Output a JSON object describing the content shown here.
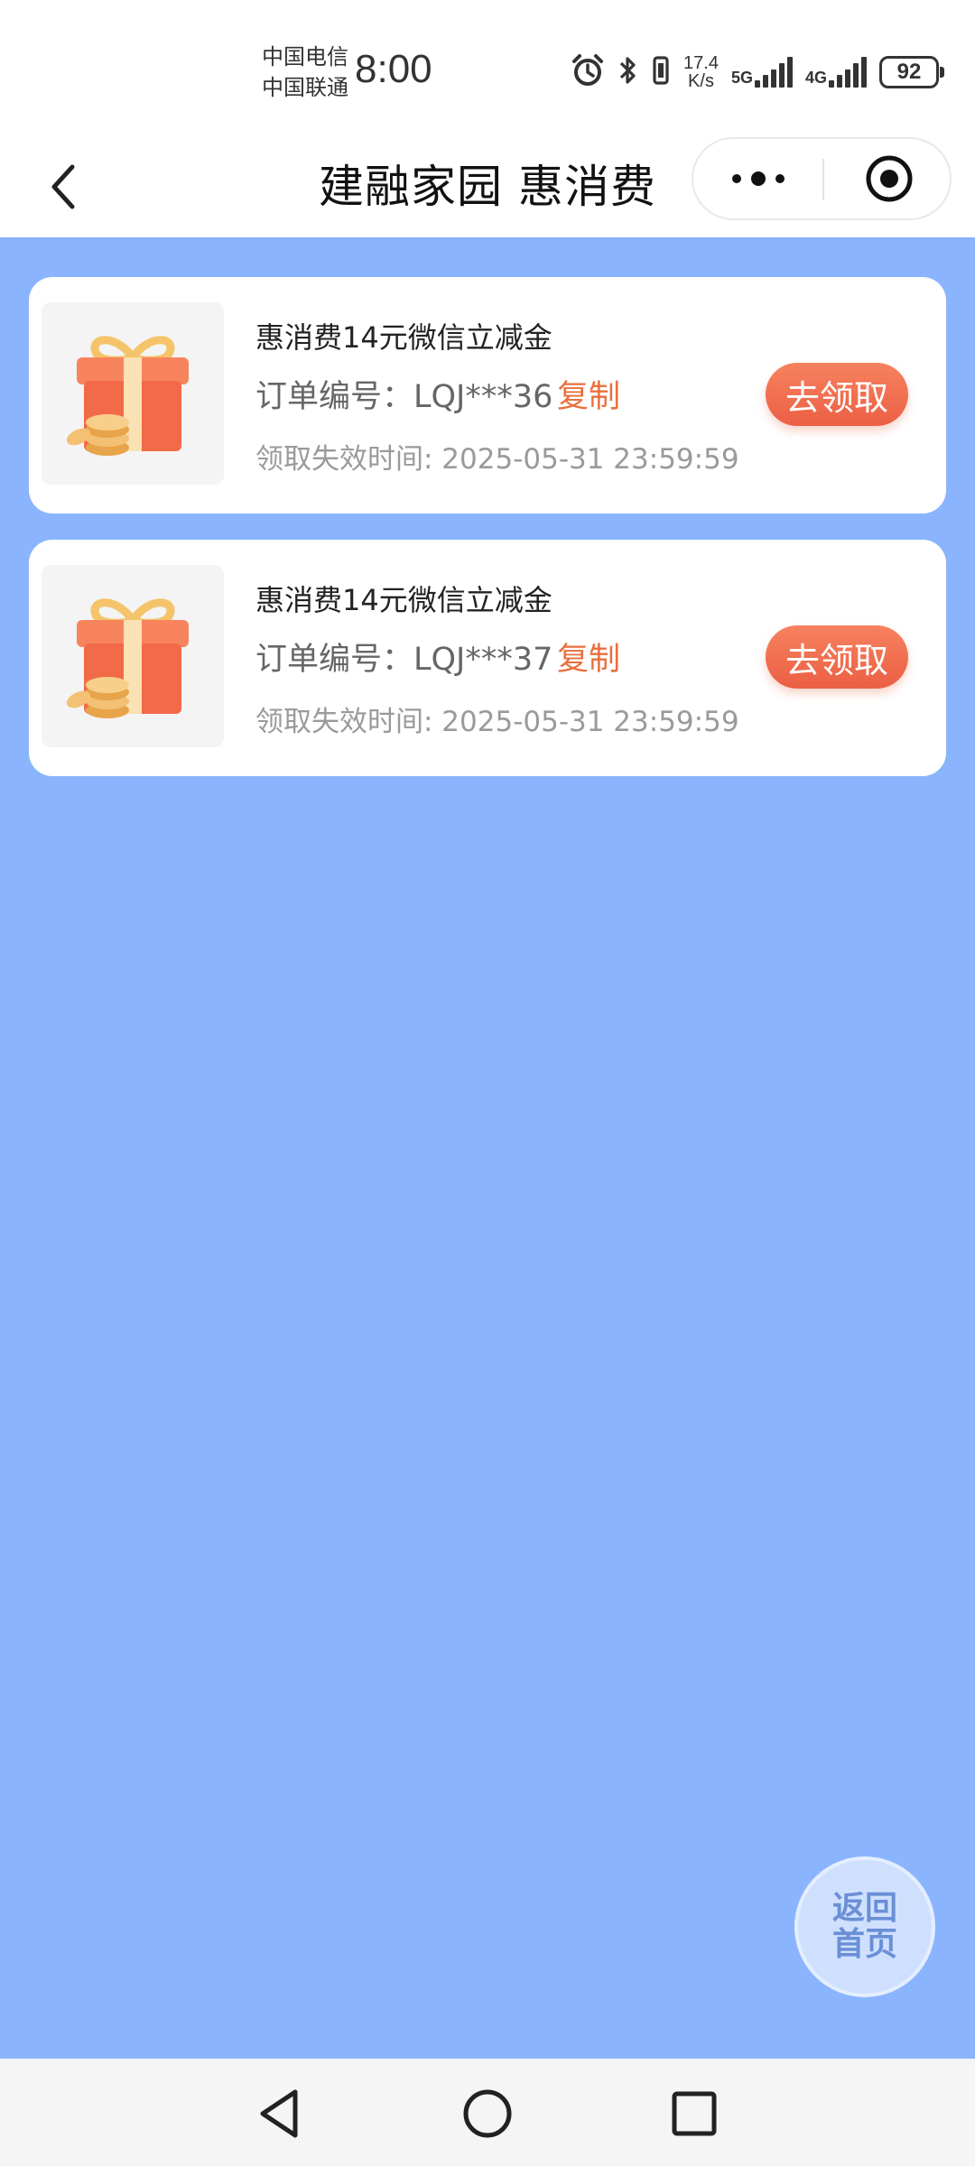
{
  "status_bar": {
    "carrier_1": "中国电信",
    "carrier_2": "中国联通",
    "time": "8:00",
    "net_speed_value": "17.4",
    "net_speed_unit": "K/s",
    "signal_1_label": "5G",
    "signal_2_label": "4G",
    "battery": "92",
    "icons": [
      "alarm-icon",
      "bluetooth-icon",
      "vibrate-icon"
    ]
  },
  "navbar": {
    "title": "建融家园 惠消费",
    "back_icon": "chevron-left-icon",
    "capsule_icons": [
      "more-dots-icon",
      "target-close-icon"
    ]
  },
  "cards": [
    {
      "title": "惠消费14元微信立减金",
      "order_text": "订单编号：LQJ***36",
      "copy_label": "复制",
      "expire_text": "领取失效时间: 2025-05-31 23:59:59",
      "button_label": "去领取",
      "image_icon": "gift-box-icon"
    },
    {
      "title": "惠消费14元微信立减金",
      "order_text": "订单编号：LQJ***37",
      "copy_label": "复制",
      "expire_text": "领取失效时间: 2025-05-31 23:59:59",
      "button_label": "去领取",
      "image_icon": "gift-box-icon"
    }
  ],
  "home_button": {
    "line_1": "返回",
    "line_2": "首页"
  },
  "system_nav": {
    "icons": [
      "back-triangle-icon",
      "home-circle-icon",
      "recents-square-icon"
    ]
  },
  "colors": {
    "page_background": "#8ab4fd",
    "accent_orange": "#ea6f3d",
    "button_gradient_top": "#f6825f",
    "button_gradient_bottom": "#ec5f45"
  }
}
